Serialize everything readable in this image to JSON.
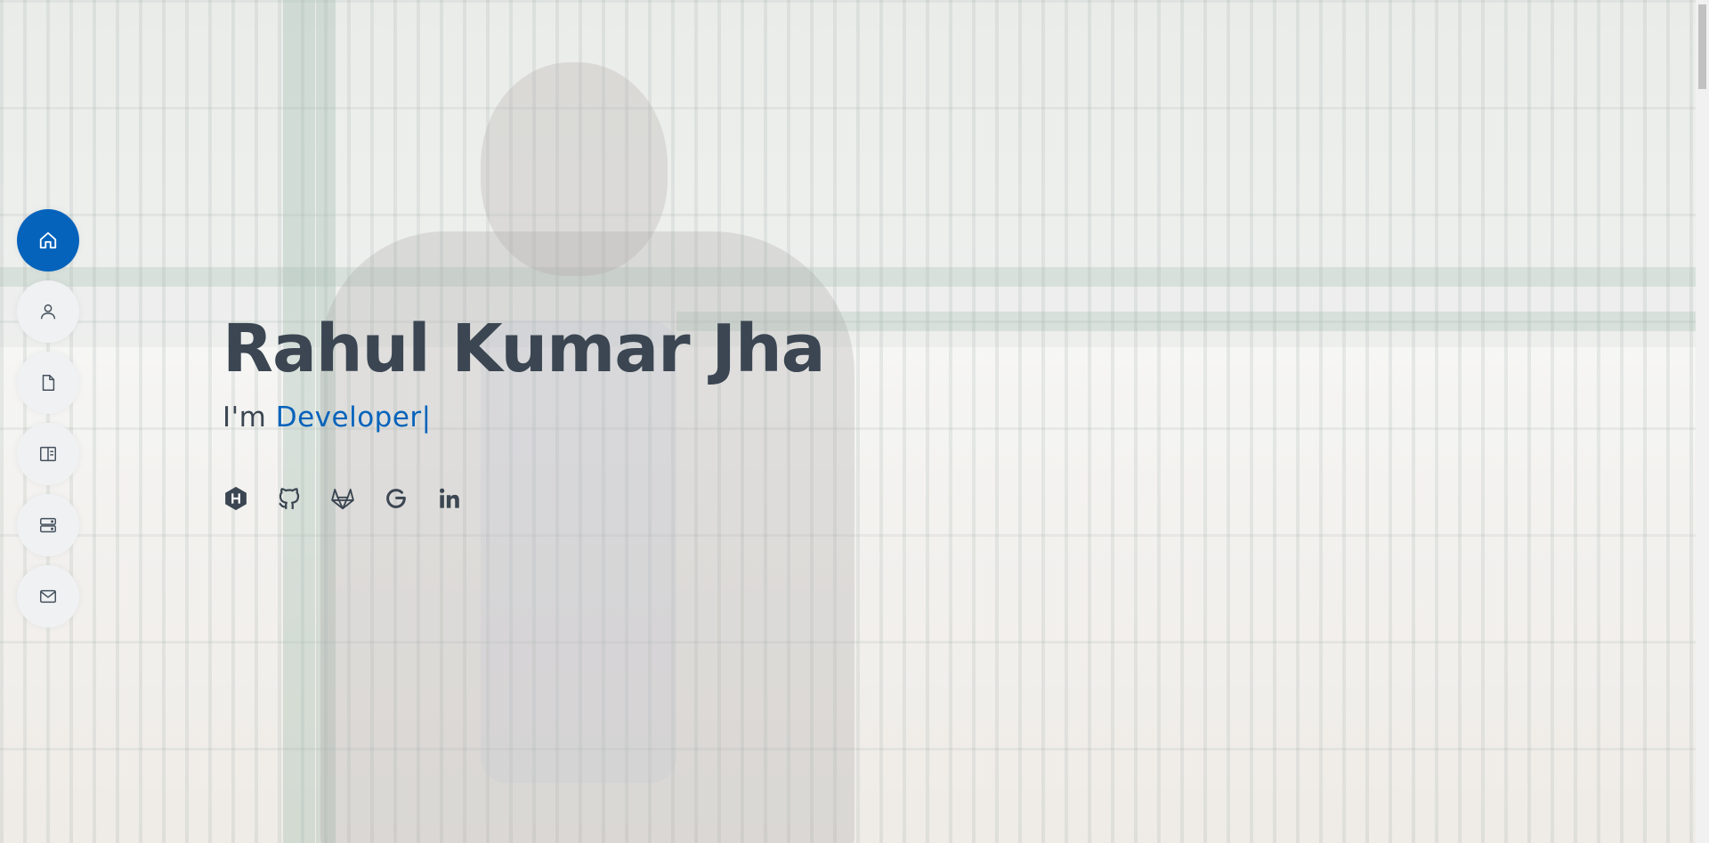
{
  "hero": {
    "name": "Rahul Kumar Jha",
    "prefix": "I'm",
    "typed": "Developer",
    "cursor": "|"
  },
  "nav": {
    "items": [
      {
        "icon": "home-icon",
        "active": true
      },
      {
        "icon": "person-icon",
        "active": false
      },
      {
        "icon": "document-icon",
        "active": false
      },
      {
        "icon": "book-icon",
        "active": false
      },
      {
        "icon": "server-icon",
        "active": false
      },
      {
        "icon": "envelope-icon",
        "active": false
      }
    ]
  },
  "social": {
    "items": [
      {
        "icon": "hackerrank-icon"
      },
      {
        "icon": "github-icon"
      },
      {
        "icon": "gitlab-icon"
      },
      {
        "icon": "google-icon"
      },
      {
        "icon": "linkedin-icon"
      }
    ]
  },
  "colors": {
    "accent": "#0563bb",
    "text": "#3b4652",
    "nav_bg": "#eff1f3"
  }
}
